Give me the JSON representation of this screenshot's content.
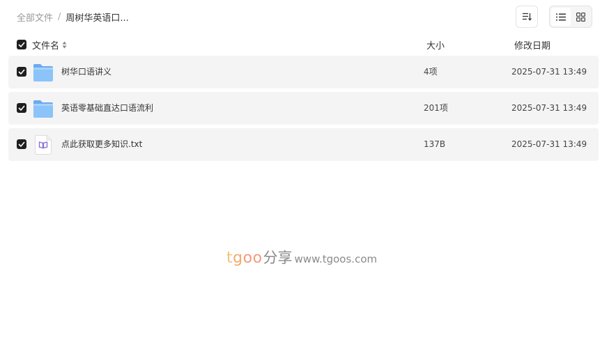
{
  "breadcrumb": {
    "root": "全部文件",
    "separator": "/",
    "current": "周树华英语口..."
  },
  "toolbar": {
    "sort_icon": "sort-list-icon",
    "list_view_icon": "list-view-icon",
    "grid_view_icon": "grid-view-icon",
    "active_view": "list"
  },
  "table": {
    "columns": {
      "name": "文件名",
      "size": "大小",
      "modified": "修改日期"
    },
    "rows": [
      {
        "name": "树华口语讲义",
        "size": "4项",
        "modified": "2025-07-31 13:49",
        "type": "folder",
        "checked": true
      },
      {
        "name": "英语零基础直达口语流利",
        "size": "201项",
        "modified": "2025-07-31 13:49",
        "type": "folder",
        "checked": true
      },
      {
        "name": "点此获取更多知识.txt",
        "size": "137B",
        "modified": "2025-07-31 13:49",
        "type": "txt",
        "checked": true
      }
    ]
  },
  "watermark": {
    "brand_t": "t",
    "brand_g": "g",
    "brand_oo": "oo",
    "chinese": "分享",
    "url": "www.tgoos.com"
  },
  "colors": {
    "row_background": "#f4f4f4",
    "checkbox": "#1f1f1f",
    "folder": "#7ab6f5",
    "txt_icon_accent": "#8b6fd6"
  }
}
